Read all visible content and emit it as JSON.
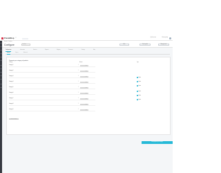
{
  "topbar": {
    "brand": "PrestaShop",
    "version": "1.7",
    "right_items": [
      "Quick access",
      "View my shop"
    ]
  },
  "sidebar": {
    "icons": [
      "dashboard-icon",
      "orders-icon",
      "catalog-icon",
      "customers-icon",
      "messages-icon",
      "stats-icon",
      "modules-icon",
      "design-icon",
      "shipping-icon",
      "payment-icon",
      "international-icon",
      "params-icon",
      "advanced-icon"
    ]
  },
  "header": {
    "breadcrumb": "Modules / Configure",
    "title": "Configure",
    "pill": "Translate",
    "buttons": [
      "Back",
      "Check update",
      "Manage hooks"
    ]
  },
  "tabs": [
    "Configuration",
    "Information",
    "Statistics",
    "Payment",
    "Shipping",
    "Customers",
    "Settings",
    "Help"
  ],
  "subtabs": [
    "General",
    "Options",
    "Advanced"
  ],
  "card": {
    "title": "Payments per category of products",
    "col_category": "Category",
    "col_amount": "Amount",
    "rows": [
      {
        "label": "Category 1",
        "value": "0,00"
      },
      {
        "label": "Category 2",
        "value": "0,00"
      },
      {
        "label": "Category 3",
        "value": "0,00"
      },
      {
        "label": "Category 4",
        "value": "0,00"
      },
      {
        "label": "Category 5",
        "value": "0,00"
      },
      {
        "label": "Category 6",
        "value": "0,00"
      },
      {
        "label": "Category 7",
        "value": "0,00"
      },
      {
        "label": "Category 8",
        "value": "0,00"
      },
      {
        "label": "Category 9",
        "value": "0,00"
      }
    ],
    "currency_symbol": "€",
    "add_label": "Add new category",
    "side_head": "Type",
    "side_options": [
      "Option",
      "Option",
      "Option",
      "Option",
      "Option",
      "Option"
    ],
    "save_label": "Save payments per category"
  },
  "colors": {
    "accent": "#25b9d7",
    "sidebar": "#363a41",
    "brand": "#d9344a"
  }
}
